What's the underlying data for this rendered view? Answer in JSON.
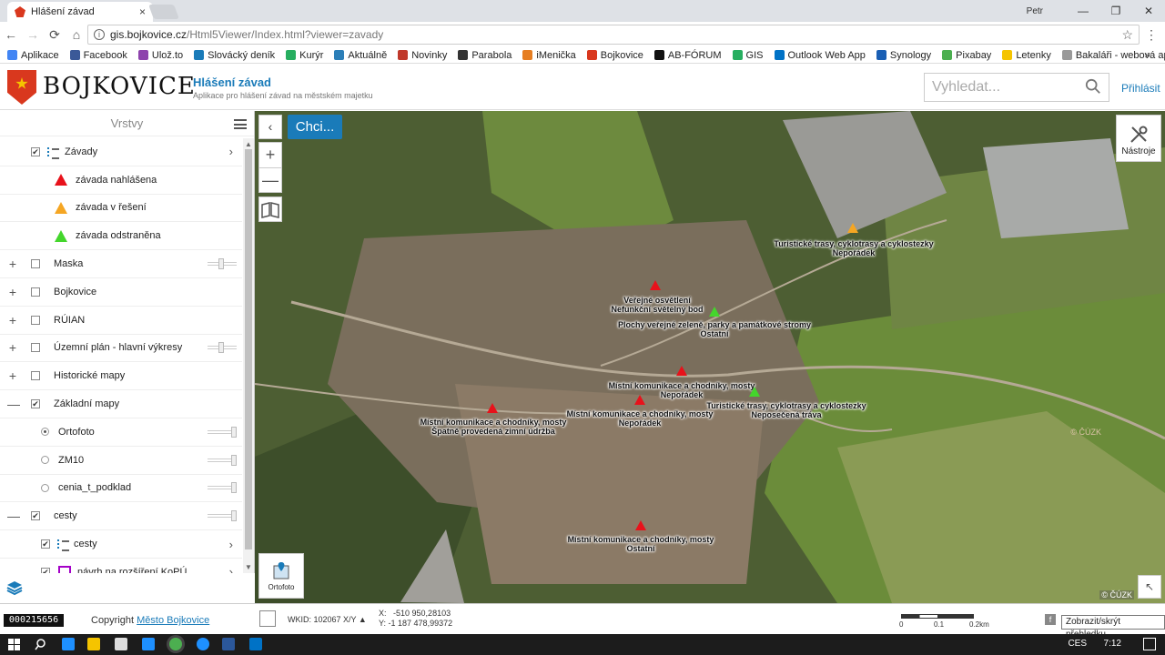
{
  "browser": {
    "tab_title": "Hlášení závad",
    "tab_close": "×",
    "user_label": "Petr",
    "win_minimize": "—",
    "win_restore": "❐",
    "win_close": "✕",
    "back": "←",
    "forward": "→",
    "reload": "⟳",
    "home": "⌂",
    "url_host": "gis.bojkovice.cz",
    "url_path": "/Html5Viewer/Index.html?viewer=zavady",
    "star": "☆",
    "menu": "⋮",
    "bookmarks": [
      {
        "label": "Aplikace",
        "color": "#4285f4"
      },
      {
        "label": "Facebook",
        "color": "#3b5998"
      },
      {
        "label": "Ulož.to",
        "color": "#8e44ad"
      },
      {
        "label": "Slovácký deník",
        "color": "#1a7bb9"
      },
      {
        "label": "Kurýr",
        "color": "#27ae60"
      },
      {
        "label": "Aktuálně",
        "color": "#2c7fb8"
      },
      {
        "label": "Novinky",
        "color": "#c0392b"
      },
      {
        "label": "Parabola",
        "color": "#333333"
      },
      {
        "label": "iMenička",
        "color": "#e67e22"
      },
      {
        "label": "Bojkovice",
        "color": "#d9381e"
      },
      {
        "label": "AB-FÓRUM",
        "color": "#111111"
      },
      {
        "label": "GIS",
        "color": "#27ae60"
      },
      {
        "label": "Outlook Web App",
        "color": "#0072c6"
      },
      {
        "label": "Synology",
        "color": "#1a5fb4"
      },
      {
        "label": "Pixabay",
        "color": "#4caf50"
      },
      {
        "label": "Letenky",
        "color": "#f5c400"
      },
      {
        "label": "Bakaláři - webová ap",
        "color": "#999999"
      }
    ],
    "bookmarks_more": "»"
  },
  "app": {
    "brand": "BOJKOVICE",
    "title": "Hlášení závad",
    "subtitle": "Aplikace pro hlášení závad na městském majetku",
    "search_placeholder": "Vyhledat...",
    "login": "Přihlásit"
  },
  "panel": {
    "title": "Vrstvy",
    "scroll_up": "▲",
    "scroll_down": "▼",
    "layers": [
      {
        "label": "Závady",
        "kind": "group-sub",
        "checked": true
      },
      {
        "label": "závada nahlášena",
        "kind": "legend",
        "color": "#e8121b"
      },
      {
        "label": "závada v řešení",
        "kind": "legend",
        "color": "#f5a623"
      },
      {
        "label": "závada odstraněna",
        "kind": "legend",
        "color": "#44d62c"
      },
      {
        "label": "Maska",
        "kind": "top",
        "expander": "+",
        "checked": false
      },
      {
        "label": "Bojkovice",
        "kind": "top",
        "expander": "+",
        "checked": false
      },
      {
        "label": "RÚIAN",
        "kind": "top",
        "expander": "+",
        "checked": false
      },
      {
        "label": "Územní plán - hlavní výkresy",
        "kind": "top",
        "expander": "+",
        "checked": false
      },
      {
        "label": "Historické mapy",
        "kind": "top",
        "expander": "+",
        "checked": false
      },
      {
        "label": "Základní mapy",
        "kind": "top",
        "expander": "—",
        "checked": true
      },
      {
        "label": "Ortofoto",
        "kind": "radio",
        "selected": true
      },
      {
        "label": "ZM10",
        "kind": "radio",
        "selected": false
      },
      {
        "label": "cenia_t_podklad",
        "kind": "radio",
        "selected": false
      },
      {
        "label": "cesty",
        "kind": "top",
        "expander": "—",
        "checked": true
      },
      {
        "label": "cesty",
        "kind": "sub",
        "checked": true
      },
      {
        "label": "návrh na rozšíření KoPÚ",
        "kind": "sub-square",
        "checked": true
      }
    ]
  },
  "map": {
    "chci_button": "Chci...",
    "collapse": "‹",
    "zoom_in": "+",
    "zoom_out": "—",
    "tools_label": "Nástroje",
    "ortofoto_label": "Ortofoto",
    "watermark": "© ČÚZK",
    "attribution": "© ČÚZK",
    "expand": "↖",
    "markers": [
      {
        "color": "#e8121b",
        "lines": [
          "Veřejné osvětlení",
          "Nefunkční světelný bod"
        ]
      },
      {
        "color": "#44d62c",
        "lines": [
          "Plochy veřejné zeleně, parky a památkové stromy",
          "Ostatní"
        ]
      },
      {
        "color": "#f5a623",
        "lines": [
          "Turistické trasy, cyklotrasy a cyklostezky",
          "Nepořádek"
        ]
      },
      {
        "color": "#e8121b",
        "lines": [
          "Místní komunikace a chodníky, mosty",
          "Nepořádek"
        ]
      },
      {
        "color": "#44d62c",
        "lines": [
          "Turistické trasy, cyklotrasy a cyklostezky",
          "Neposečená tráva"
        ]
      },
      {
        "color": "#e8121b",
        "lines": [
          "Místní komunikace a chodníky, mosty",
          "Nepořádek"
        ]
      },
      {
        "color": "#e8121b",
        "lines": [
          "Místní komunikace a chodníky, mosty",
          "Špatně provedená zimní údržba"
        ]
      },
      {
        "color": "#e8121b",
        "lines": [
          "Místní komunikace a chodníky, mosty",
          "Ostatní"
        ]
      }
    ]
  },
  "status": {
    "counter": "000215656",
    "copyright_prefix": "Copyright",
    "copyright_link": "Město Bojkovice",
    "wkid": "WKID: 102067 X/Y ▲",
    "x_label": "X:",
    "x_value": "-510 950,28103",
    "y_label": "Y:",
    "y_value": "-1 187 478,99372",
    "scale_0": "0",
    "scale_1": "0.1",
    "scale_2": "0.2km",
    "fb": "f",
    "tooltip": "Zobrazit/skrýt přehledku"
  },
  "taskbar": {
    "lang": "CES",
    "time": "7:12"
  }
}
